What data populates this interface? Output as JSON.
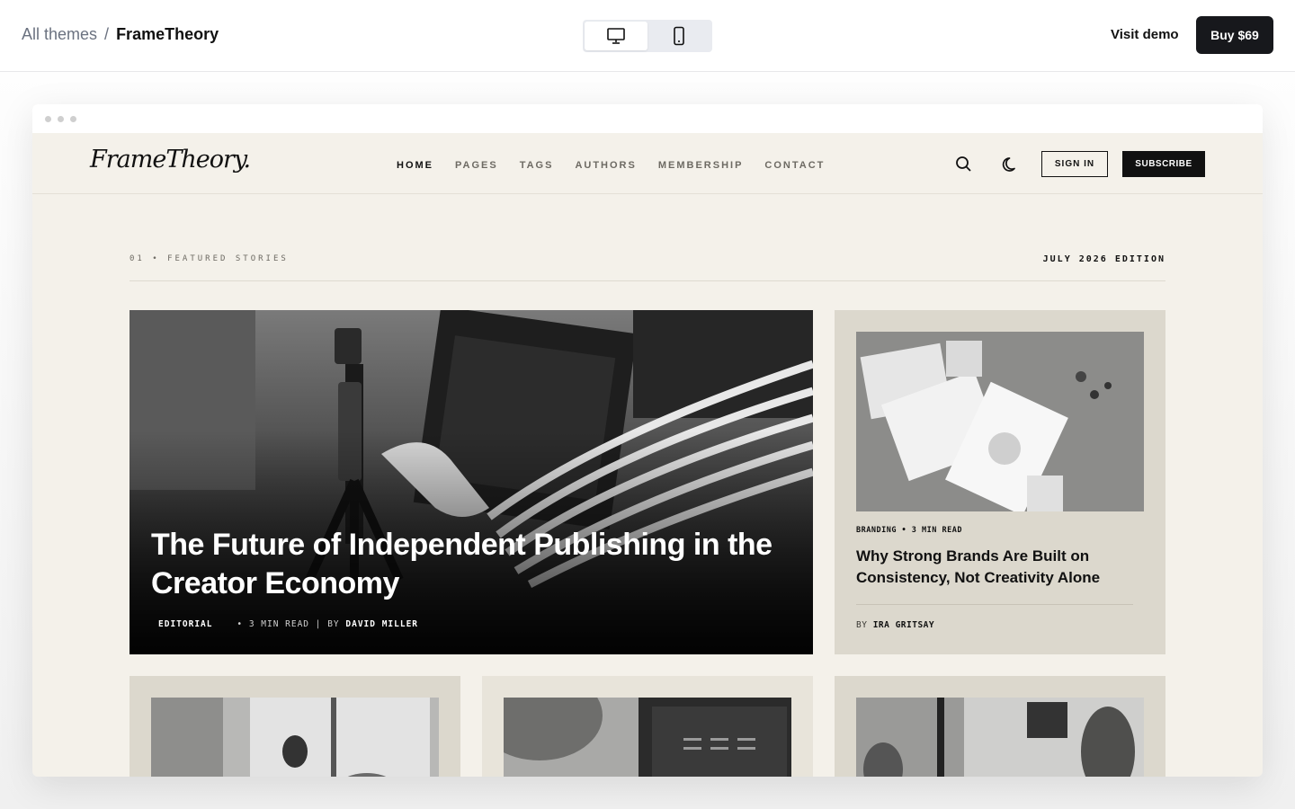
{
  "topbar": {
    "breadcrumb_root": "All themes",
    "breadcrumb_sep": "/",
    "breadcrumb_current": "FrameTheory",
    "visit_demo": "Visit demo",
    "buy_label": "Buy $69"
  },
  "site": {
    "logo": "FrameTheory.",
    "nav": [
      "HOME",
      "PAGES",
      "TAGS",
      "AUTHORS",
      "MEMBERSHIP",
      "CONTACT"
    ],
    "sign_in": "SIGN IN",
    "subscribe": "SUBSCRIBE"
  },
  "section": {
    "label": "01 • FEATURED STORIES",
    "edition": "JULY 2026 EDITION"
  },
  "hero": {
    "title": "The Future of Independent Publishing in the Creator Economy",
    "tag": "EDITORIAL",
    "read_time": "• 3 MIN READ",
    "by": "| BY",
    "author": "DAVID MILLER"
  },
  "side_card": {
    "meta": "BRANDING • 3 MIN READ",
    "title": "Why Strong Brands Are Built on Consistency, Not Creativity Alone",
    "by": "BY",
    "author": "IRA GRITSAY"
  },
  "colors": {
    "page_bg": "#f4f1ea",
    "card_bg": "#dcd8cd",
    "ink": "#111111",
    "buy_button": "#17181c"
  }
}
